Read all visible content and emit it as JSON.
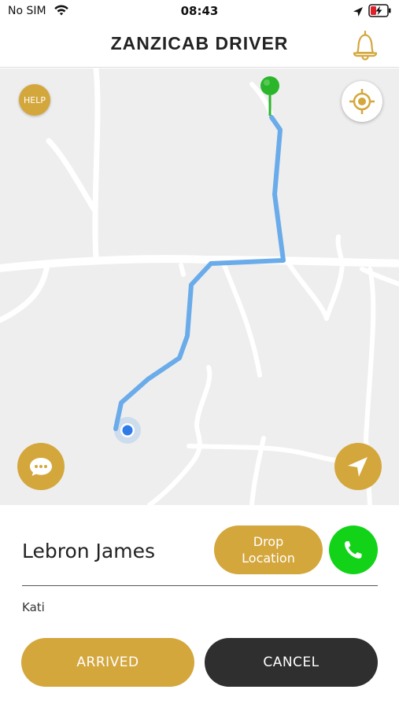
{
  "status_bar": {
    "carrier": "No SIM",
    "time": "08:43",
    "icons": [
      "wifi-icon",
      "location-arrow-icon",
      "battery-charging-icon"
    ]
  },
  "header": {
    "title": "ZANZICAB DRIVER",
    "notification_icon": "bell-icon"
  },
  "map": {
    "help_label": "HELP",
    "icons": [
      "destination-pin-icon",
      "current-location-dot-icon",
      "locate-me-icon",
      "chat-bubble-icon",
      "navigate-arrow-icon"
    ],
    "route_color": "#6aabea",
    "pin_color": "#2bb52b"
  },
  "trip": {
    "passenger_name": "Lebron James",
    "drop_location_label": "Drop Location",
    "pickup_location": "Kati",
    "call_icon": "phone-icon"
  },
  "actions": {
    "arrived_label": "ARRIVED",
    "cancel_label": "CANCEL"
  },
  "colors": {
    "accent": "#d4a73d",
    "call": "#12d318",
    "cancel": "#2f2f2f"
  }
}
